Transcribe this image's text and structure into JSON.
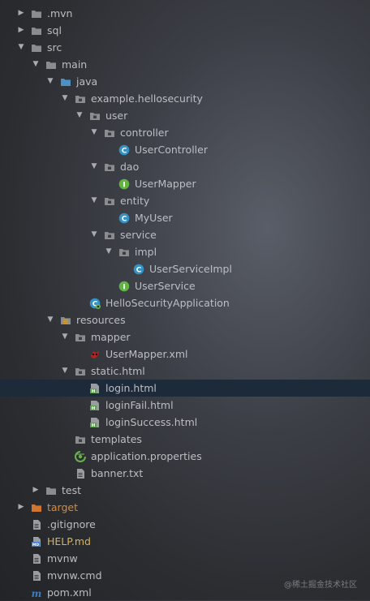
{
  "rows": [
    {
      "label": ".mvn",
      "depth": 1,
      "arrow": "right",
      "icon": "folder",
      "style": "normal"
    },
    {
      "label": "sql",
      "depth": 1,
      "arrow": "right",
      "icon": "folder",
      "style": "normal"
    },
    {
      "label": "src",
      "depth": 1,
      "arrow": "down",
      "icon": "folder",
      "style": "normal"
    },
    {
      "label": "main",
      "depth": 2,
      "arrow": "down",
      "icon": "folder",
      "style": "normal"
    },
    {
      "label": "java",
      "depth": 3,
      "arrow": "down",
      "icon": "folder-blue",
      "style": "normal"
    },
    {
      "label": "example.hellosecurity",
      "depth": 4,
      "arrow": "down",
      "icon": "package",
      "style": "normal"
    },
    {
      "label": "user",
      "depth": 5,
      "arrow": "down",
      "icon": "package",
      "style": "normal"
    },
    {
      "label": "controller",
      "depth": 6,
      "arrow": "down",
      "icon": "package",
      "style": "normal"
    },
    {
      "label": "UserController",
      "depth": 7,
      "arrow": "none",
      "icon": "class",
      "style": "normal"
    },
    {
      "label": "dao",
      "depth": 6,
      "arrow": "down",
      "icon": "package",
      "style": "normal"
    },
    {
      "label": "UserMapper",
      "depth": 7,
      "arrow": "none",
      "icon": "interface",
      "style": "normal"
    },
    {
      "label": "entity",
      "depth": 6,
      "arrow": "down",
      "icon": "package",
      "style": "normal"
    },
    {
      "label": "MyUser",
      "depth": 7,
      "arrow": "none",
      "icon": "class",
      "style": "normal"
    },
    {
      "label": "service",
      "depth": 6,
      "arrow": "down",
      "icon": "package",
      "style": "normal"
    },
    {
      "label": "impl",
      "depth": 7,
      "arrow": "down",
      "icon": "package",
      "style": "normal"
    },
    {
      "label": "UserServiceImpl",
      "depth": 8,
      "arrow": "none",
      "icon": "class",
      "style": "normal"
    },
    {
      "label": "UserService",
      "depth": 7,
      "arrow": "none",
      "icon": "interface",
      "style": "normal"
    },
    {
      "label": "HelloSecurityApplication",
      "depth": 5,
      "arrow": "none",
      "icon": "spring-class",
      "style": "normal"
    },
    {
      "label": "resources",
      "depth": 3,
      "arrow": "down",
      "icon": "resources-folder",
      "style": "normal"
    },
    {
      "label": "mapper",
      "depth": 4,
      "arrow": "down",
      "icon": "package",
      "style": "normal"
    },
    {
      "label": "UserMapper.xml",
      "depth": 5,
      "arrow": "none",
      "icon": "mybatis-xml",
      "style": "normal"
    },
    {
      "label": "static.html",
      "depth": 4,
      "arrow": "down",
      "icon": "package",
      "style": "normal"
    },
    {
      "label": "login.html",
      "depth": 5,
      "arrow": "none",
      "icon": "html-file",
      "style": "normal",
      "selected": true
    },
    {
      "label": "loginFail.html",
      "depth": 5,
      "arrow": "none",
      "icon": "html-file",
      "style": "normal"
    },
    {
      "label": "loginSuccess.html",
      "depth": 5,
      "arrow": "none",
      "icon": "html-file",
      "style": "normal"
    },
    {
      "label": "templates",
      "depth": 4,
      "arrow": "none",
      "icon": "package",
      "style": "normal"
    },
    {
      "label": "application.properties",
      "depth": 4,
      "arrow": "none",
      "icon": "properties-file",
      "style": "normal"
    },
    {
      "label": "banner.txt",
      "depth": 4,
      "arrow": "none",
      "icon": "text-file",
      "style": "normal"
    },
    {
      "label": "test",
      "depth": 2,
      "arrow": "right",
      "icon": "folder",
      "style": "normal"
    },
    {
      "label": "target",
      "depth": 1,
      "arrow": "right",
      "icon": "folder-orange",
      "style": "orange"
    },
    {
      "label": ".gitignore",
      "depth": 1,
      "arrow": "none",
      "icon": "text-file",
      "style": "normal"
    },
    {
      "label": "HELP.md",
      "depth": 1,
      "arrow": "none",
      "icon": "markdown-file",
      "style": "yellow"
    },
    {
      "label": "mvnw",
      "depth": 1,
      "arrow": "none",
      "icon": "text-file",
      "style": "normal"
    },
    {
      "label": "mvnw.cmd",
      "depth": 1,
      "arrow": "none",
      "icon": "text-file",
      "style": "normal"
    },
    {
      "label": "pom.xml",
      "depth": 1,
      "arrow": "none",
      "icon": "maven-file",
      "style": "normal"
    }
  ],
  "watermark": "@稀土掘金技术社区",
  "colors": {
    "folder": "#8a8c8f",
    "folder_blue": "#4e8fc4",
    "folder_orange": "#d0752c",
    "class_icon": "#3592c4",
    "interface_icon": "#62b543",
    "html_icon": "#5aa04a",
    "selection": "#1c2a3a",
    "text": "#bcbec4"
  }
}
